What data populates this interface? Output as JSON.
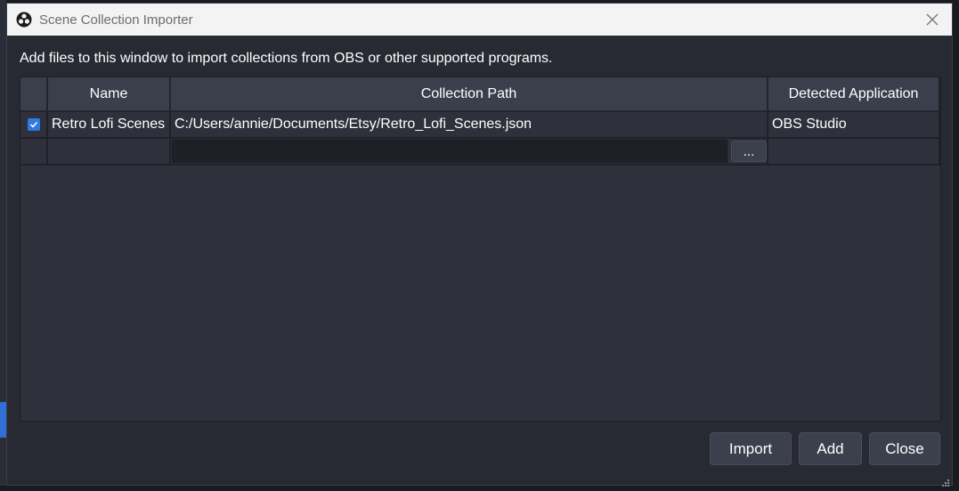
{
  "window": {
    "title": "Scene Collection Importer",
    "app_icon": "obs-logo-icon",
    "close_icon": "close-icon"
  },
  "description": "Add files to this window to import collections from OBS or other supported programs.",
  "table": {
    "columns": [
      "",
      "Name",
      "Collection Path",
      "Detected Application"
    ],
    "rows": [
      {
        "checked": true,
        "name": "Retro Lofi Scenes",
        "path": "C:/Users/annie/Documents/Etsy/Retro_Lofi_Scenes.json",
        "application": "OBS Studio"
      }
    ],
    "new_row": {
      "path_value": "",
      "browse_label": "..."
    }
  },
  "buttons": {
    "import": "Import",
    "add": "Add",
    "close": "Close"
  },
  "colors": {
    "accent": "#2f79e0",
    "dialog_bg": "#272a33",
    "table_bg": "#2e313c",
    "header_bg": "#3b3f4c"
  }
}
